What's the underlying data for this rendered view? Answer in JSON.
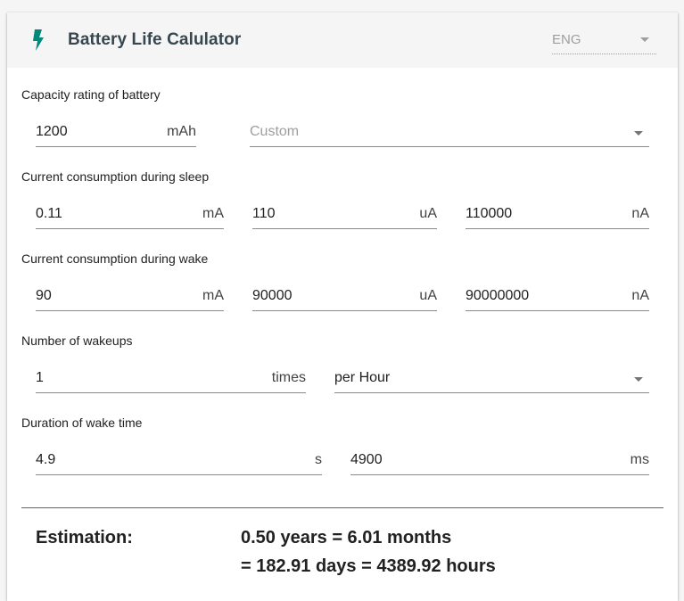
{
  "app": {
    "title": "Battery Life Calulator",
    "language": "ENG",
    "accent_color": "#00897b"
  },
  "capacity": {
    "label": "Capacity rating of battery",
    "value": "1200",
    "unit": "mAh",
    "preset": {
      "placeholder": "Custom"
    }
  },
  "sleep_current": {
    "label": "Current consumption during sleep",
    "fields": [
      {
        "value": "0.11",
        "unit": "mA"
      },
      {
        "value": "110",
        "unit": "uA"
      },
      {
        "value": "110000",
        "unit": "nA"
      }
    ]
  },
  "wake_current": {
    "label": "Current consumption during wake",
    "fields": [
      {
        "value": "90",
        "unit": "mA"
      },
      {
        "value": "90000",
        "unit": "uA"
      },
      {
        "value": "90000000",
        "unit": "nA"
      }
    ]
  },
  "wakeups": {
    "label": "Number of wakeups",
    "value": "1",
    "unit": "times",
    "period": "per Hour"
  },
  "wake_duration": {
    "label": "Duration of wake time",
    "fields": [
      {
        "value": "4.9",
        "unit": "s"
      },
      {
        "value": "4900",
        "unit": "ms"
      }
    ]
  },
  "estimation": {
    "label": "Estimation:",
    "line1": "0.50 years = 6.01 months",
    "line2": "= 182.91 days = 4389.92 hours"
  }
}
